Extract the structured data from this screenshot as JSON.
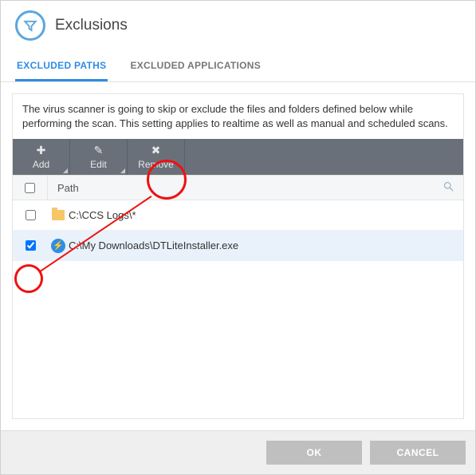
{
  "header": {
    "title": "Exclusions"
  },
  "tabs": {
    "excluded_paths": "EXCLUDED PATHS",
    "excluded_apps": "EXCLUDED APPLICATIONS"
  },
  "description": "The virus scanner is going to skip or exclude the files and folders defined below while performing the scan. This setting applies to realtime as well as manual and scheduled scans.",
  "toolbar": {
    "add": "Add",
    "edit": "Edit",
    "remove": "Remove"
  },
  "columns": {
    "path": "Path"
  },
  "rows": [
    {
      "checked": false,
      "icon": "folder",
      "path": "C:\\CCS Logs\\*"
    },
    {
      "checked": true,
      "icon": "exe",
      "path": "C:\\My Downloads\\DTLiteInstaller.exe"
    }
  ],
  "footer": {
    "ok": "OK",
    "cancel": "CANCEL"
  }
}
